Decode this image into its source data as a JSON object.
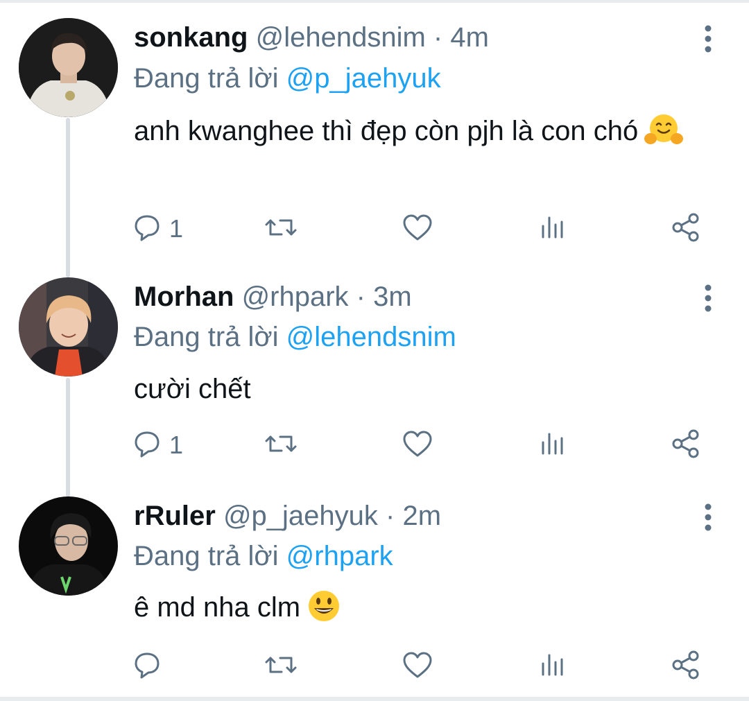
{
  "tweets": [
    {
      "name": "sonkang",
      "handle": "@lehendsnim",
      "dot": "·",
      "time": "4m",
      "reply_prefix": "Đang trả lời",
      "reply_to": "@p_jaehyuk",
      "text": "anh kwanghee thì đẹp còn pjh là con chó",
      "emoji": "hugging-face-icon",
      "reply_count": "1"
    },
    {
      "name": "Morhan",
      "handle": "@rhpark",
      "dot": "·",
      "time": "3m",
      "reply_prefix": "Đang trả lời",
      "reply_to": "@lehendsnim",
      "text": "cười chết",
      "reply_count": "1"
    },
    {
      "name": "rRuler",
      "handle": "@p_jaehyuk",
      "dot": "·",
      "time": "2m",
      "reply_prefix": "Đang trả lời",
      "reply_to": "@rhpark",
      "text": "ê md nha clm",
      "emoji": "grinning-face-icon",
      "reply_count": ""
    }
  ],
  "colors": {
    "text": "#0f1419",
    "secondary": "#5b7083",
    "mention": "#1da1f2",
    "thread_line": "#d7dde2"
  },
  "icons": [
    "reply-icon",
    "retweet-icon",
    "like-icon",
    "analytics-icon",
    "share-icon",
    "more-icon"
  ]
}
